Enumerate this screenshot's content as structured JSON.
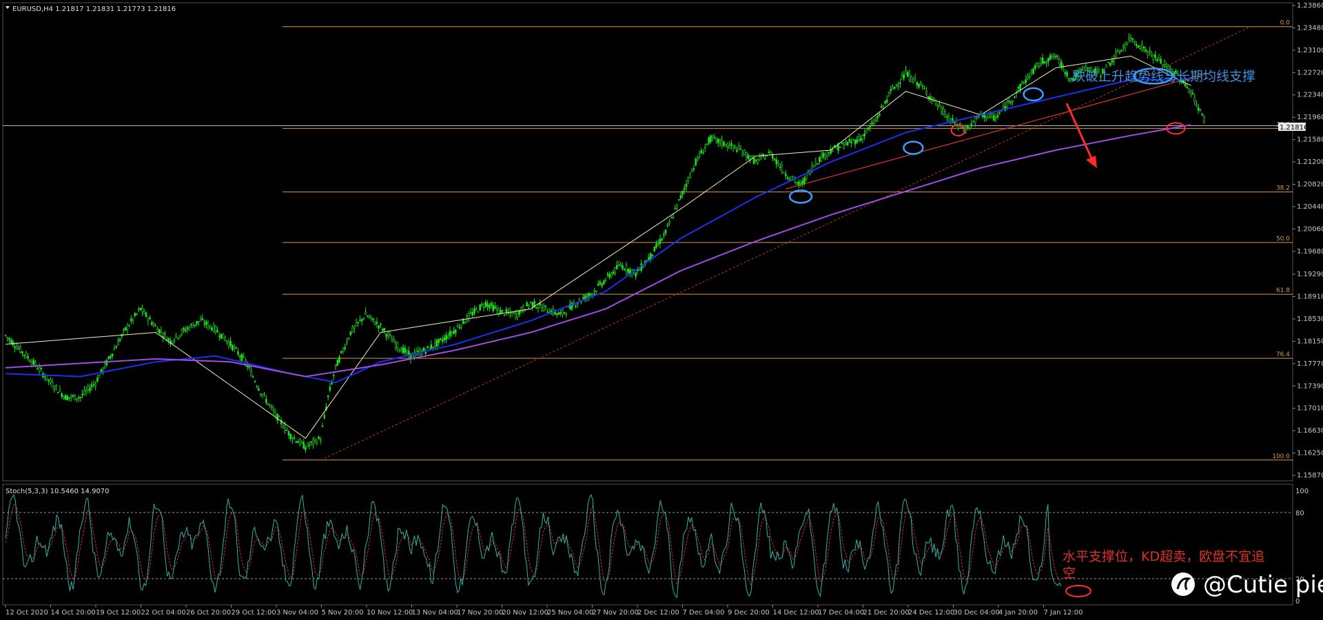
{
  "window": {
    "symbol_header": "EURUSD,H4  1.21817 1.21831 1.21773 1.21816",
    "stoch_header": "Stoch(5,3,3) 10.5460 14.9070"
  },
  "watermark": {
    "text": "@Cutie pie",
    "icon": "weibo-like-logo-icon"
  },
  "annotations": {
    "blue_note": "跌破上升趋势线与长期均线支撑",
    "red_note_line1": "水平支撑位，KD超卖，欧盘不宜追",
    "red_note_line2": "空"
  },
  "colors": {
    "background": "#000000",
    "candles": "#19e019",
    "fast_ma": "#f5f0b0",
    "medium_ma": "#1e2ff5",
    "slow_ma": "#a24ce8",
    "fib_levels": "#d99a4a",
    "trend_line": "#d1322a",
    "stoch_main": "#2fb3a8",
    "stoch_signal": "#d1322a",
    "highlight_blue": "#3aa0ff",
    "highlight_red": "#ff3030"
  },
  "chart_data": {
    "type": "candlestick",
    "symbol": "EURUSD",
    "timeframe": "H4",
    "current_price": "1.21816",
    "ohlc": {
      "open": 1.21817,
      "high": 1.21831,
      "low": 1.21773,
      "close": 1.21816
    },
    "y_ticks": [
      "1.23860",
      "1.23480",
      "1.23100",
      "1.22720",
      "1.22340",
      "1.21960",
      "1.21580",
      "1.21200",
      "1.20820",
      "1.20440",
      "1.20060",
      "1.19680",
      "1.19290",
      "1.18910",
      "1.18530",
      "1.18150",
      "1.17770",
      "1.17390",
      "1.17010",
      "1.16630",
      "1.16250",
      "1.15870"
    ],
    "ylim": [
      1.1587,
      1.2386
    ],
    "x_ticks": [
      "12 Oct 2020",
      "14 Oct 20:00",
      "19 Oct 12:00",
      "22 Oct 04:00",
      "26 Oct 20:00",
      "29 Oct 12:00",
      "3 Nov 04:00",
      "5 Nov 20:00",
      "10 Nov 12:00",
      "13 Nov 04:00",
      "17 Nov 20:00",
      "20 Nov 12:00",
      "25 Nov 04:00",
      "27 Nov 20:00",
      "2 Dec 12:00",
      "7 Dec 04:00",
      "9 Dec 20:00",
      "14 Dec 12:00",
      "17 Dec 04:00",
      "21 Dec 20:00",
      "24 Dec 12:00",
      "30 Dec 04:00",
      "4 Jan 20:00",
      "7 Jan 12:00"
    ],
    "fibonacci": [
      {
        "label": "0.0",
        "price": 1.235
      },
      {
        "label": "23.6",
        "price": 1.2177
      },
      {
        "label": "38.2",
        "price": 1.2069
      },
      {
        "label": "50.0",
        "price": 1.1983
      },
      {
        "label": "61.8",
        "price": 1.1895
      },
      {
        "label": "76.4",
        "price": 1.1786
      },
      {
        "label": "100.0",
        "price": 1.1613
      }
    ],
    "price_path": [
      [
        0,
        1.1825
      ],
      [
        2,
        1.18
      ],
      [
        4,
        1.1775
      ],
      [
        6,
        1.1745
      ],
      [
        8,
        1.172
      ],
      [
        10,
        1.172
      ],
      [
        12,
        1.1745
      ],
      [
        14,
        1.179
      ],
      [
        16,
        1.1835
      ],
      [
        18,
        1.187
      ],
      [
        20,
        1.184
      ],
      [
        22,
        1.1815
      ],
      [
        24,
        1.1835
      ],
      [
        26,
        1.185
      ],
      [
        28,
        1.1835
      ],
      [
        30,
        1.181
      ],
      [
        32,
        1.178
      ],
      [
        34,
        1.173
      ],
      [
        36,
        1.169
      ],
      [
        38,
        1.1655
      ],
      [
        40,
        1.1635
      ],
      [
        42,
        1.165
      ],
      [
        43,
        1.172
      ],
      [
        44,
        1.177
      ],
      [
        46,
        1.183
      ],
      [
        48,
        1.186
      ],
      [
        50,
        1.184
      ],
      [
        52,
        1.181
      ],
      [
        54,
        1.179
      ],
      [
        56,
        1.18
      ],
      [
        58,
        1.1815
      ],
      [
        60,
        1.1835
      ],
      [
        62,
        1.186
      ],
      [
        64,
        1.188
      ],
      [
        66,
        1.1865
      ],
      [
        68,
        1.186
      ],
      [
        70,
        1.188
      ],
      [
        72,
        1.187
      ],
      [
        74,
        1.186
      ],
      [
        76,
        1.188
      ],
      [
        78,
        1.1895
      ],
      [
        80,
        1.192
      ],
      [
        82,
        1.1945
      ],
      [
        84,
        1.193
      ],
      [
        86,
        1.196
      ],
      [
        88,
        1.2
      ],
      [
        90,
        1.206
      ],
      [
        92,
        1.212
      ],
      [
        94,
        1.216
      ],
      [
        96,
        1.215
      ],
      [
        98,
        1.214
      ],
      [
        100,
        1.212
      ],
      [
        102,
        1.2135
      ],
      [
        104,
        1.21
      ],
      [
        106,
        1.208
      ],
      [
        108,
        1.212
      ],
      [
        110,
        1.214
      ],
      [
        112,
        1.215
      ],
      [
        114,
        1.216
      ],
      [
        116,
        1.219
      ],
      [
        118,
        1.224
      ],
      [
        120,
        1.227
      ],
      [
        122,
        1.225
      ],
      [
        124,
        1.222
      ],
      [
        126,
        1.219
      ],
      [
        128,
        1.2175
      ],
      [
        130,
        1.22
      ],
      [
        132,
        1.2195
      ],
      [
        134,
        1.2225
      ],
      [
        136,
        1.226
      ],
      [
        138,
        1.229
      ],
      [
        140,
        1.23
      ],
      [
        142,
        1.226
      ],
      [
        144,
        1.228
      ],
      [
        146,
        1.227
      ],
      [
        148,
        1.23
      ],
      [
        150,
        1.233
      ],
      [
        152,
        1.231
      ],
      [
        154,
        1.229
      ],
      [
        156,
        1.227
      ],
      [
        158,
        1.224
      ],
      [
        160,
        1.2185
      ]
    ],
    "bars_total": 160,
    "moving_averages": [
      {
        "name": "fast",
        "points": [
          [
            0,
            1.181
          ],
          [
            20,
            1.183
          ],
          [
            40,
            1.165
          ],
          [
            50,
            1.183
          ],
          [
            70,
            1.187
          ],
          [
            90,
            1.204
          ],
          [
            100,
            1.213
          ],
          [
            110,
            1.214
          ],
          [
            120,
            1.224
          ],
          [
            130,
            1.22
          ],
          [
            140,
            1.228
          ],
          [
            150,
            1.23
          ],
          [
            158,
            1.225
          ]
        ]
      },
      {
        "name": "medium",
        "points": [
          [
            0,
            1.176
          ],
          [
            10,
            1.1755
          ],
          [
            20,
            1.178
          ],
          [
            28,
            1.179
          ],
          [
            38,
            1.176
          ],
          [
            44,
            1.1745
          ],
          [
            50,
            1.178
          ],
          [
            60,
            1.181
          ],
          [
            70,
            1.185
          ],
          [
            80,
            1.19
          ],
          [
            90,
            1.199
          ],
          [
            100,
            1.206
          ],
          [
            110,
            1.212
          ],
          [
            120,
            1.217
          ],
          [
            130,
            1.22
          ],
          [
            140,
            1.223
          ],
          [
            150,
            1.226
          ],
          [
            158,
            1.226
          ]
        ]
      },
      {
        "name": "slow",
        "points": [
          [
            0,
            1.177
          ],
          [
            20,
            1.1785
          ],
          [
            30,
            1.178
          ],
          [
            40,
            1.1755
          ],
          [
            50,
            1.1775
          ],
          [
            60,
            1.18
          ],
          [
            70,
            1.183
          ],
          [
            80,
            1.187
          ],
          [
            90,
            1.1935
          ],
          [
            100,
            1.1985
          ],
          [
            110,
            1.203
          ],
          [
            120,
            1.207
          ],
          [
            130,
            1.211
          ],
          [
            140,
            1.214
          ],
          [
            150,
            1.2165
          ],
          [
            158,
            1.2183
          ]
        ]
      }
    ],
    "trend_line": [
      [
        42,
        1.1613
      ],
      [
        166,
        1.235
      ]
    ],
    "stochastic": {
      "name": "Stoch(5,3,3)",
      "main_last": 10.546,
      "signal_last": 14.907,
      "levels": [
        80,
        20
      ],
      "ylim": [
        0,
        100
      ],
      "axis_labels": [
        "100",
        "80",
        "20",
        "0"
      ]
    }
  }
}
